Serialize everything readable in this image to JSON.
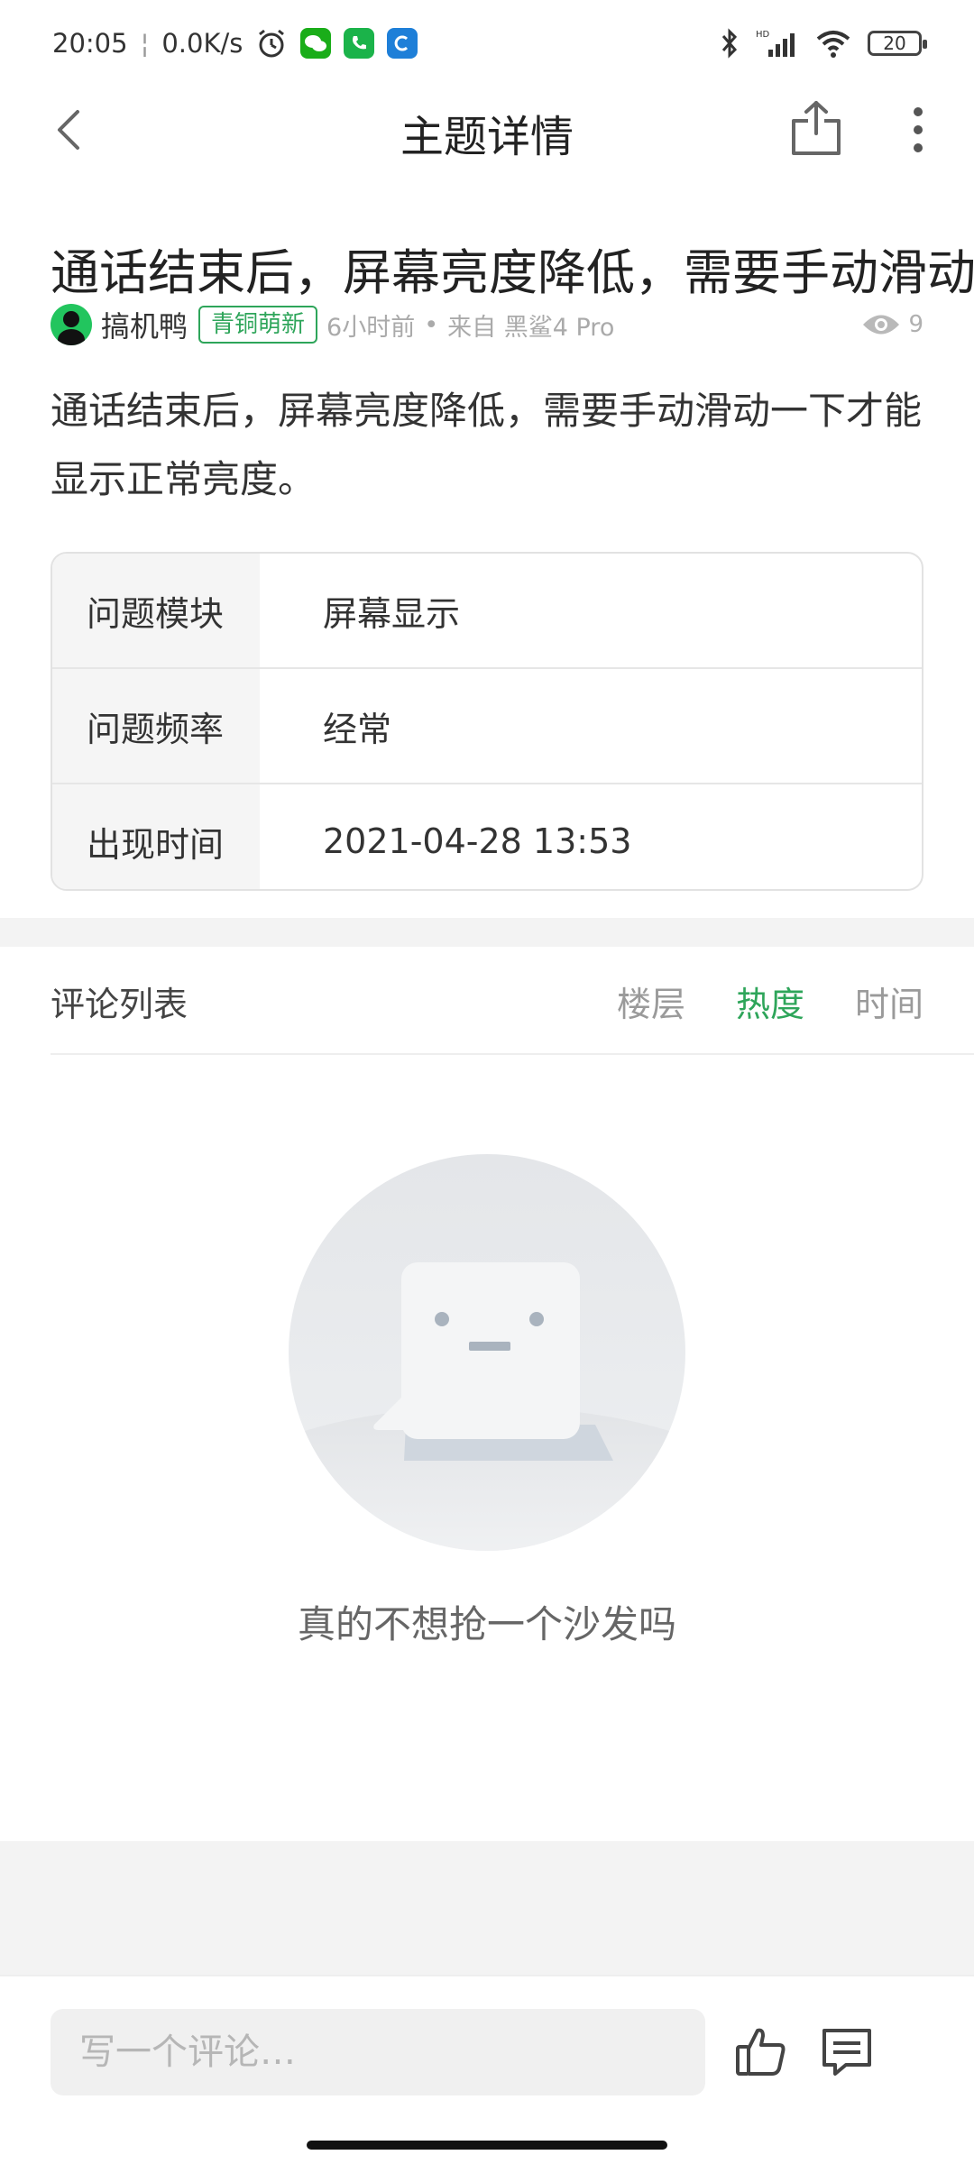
{
  "status_bar": {
    "time": "20:05",
    "net_speed": "0.0K/s",
    "battery": "20",
    "icons": [
      "alarm-icon",
      "wechat-icon",
      "phone-icon",
      "app-icon",
      "bluetooth-icon",
      "signal-icon",
      "wifi-icon"
    ]
  },
  "header": {
    "title": "主题详情"
  },
  "post": {
    "title": "通话结束后，屏幕亮度降低，需要手动滑动一",
    "author": "搞机鸭",
    "badge": "青铜萌新",
    "time": "6小时前",
    "separator": "•",
    "source": "来自 黑鲨4 Pro",
    "views": "9",
    "body": "通话结束后，屏幕亮度降低，需要手动滑动一下才能显示正常亮度。"
  },
  "info_table": {
    "rows": [
      {
        "key": "问题模块",
        "value": "屏幕显示"
      },
      {
        "key": "问题频率",
        "value": "经常"
      },
      {
        "key": "出现时间",
        "value": "2021-04-28 13:53"
      }
    ]
  },
  "comments": {
    "title": "评论列表",
    "tabs": [
      "楼层",
      "热度",
      "时间"
    ],
    "active_tab": "热度",
    "empty_text": "真的不想抢一个沙发吗"
  },
  "bottom_bar": {
    "placeholder": "写一个评论…"
  },
  "colors": {
    "accent": "#2ea55a",
    "separator": "#f3f3f3"
  }
}
